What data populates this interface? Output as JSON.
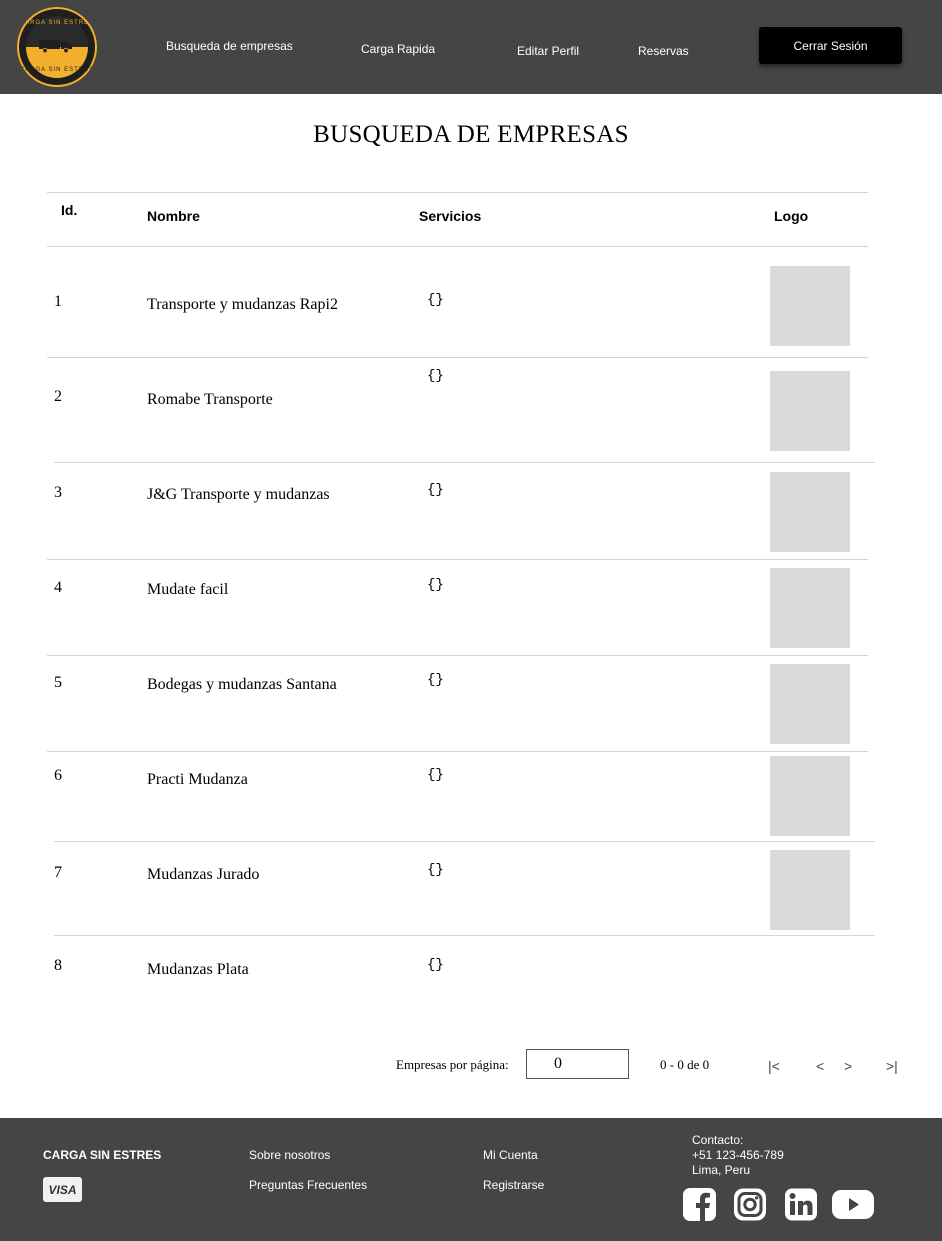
{
  "header": {
    "logo_text_top": "CARGA SIN ESTRES",
    "logo_text_bottom": "CARGA SIN ESTRES",
    "nav": [
      "Busqueda de empresas",
      "Carga Rapida",
      "Editar Perfil",
      "Reservas"
    ],
    "logout_label": "Cerrar Sesión"
  },
  "page_title": "BUSQUEDA DE EMPRESAS",
  "table": {
    "headers": {
      "id": "Id.",
      "name": "Nombre",
      "services": "Servicios",
      "logo": "Logo"
    },
    "rows": [
      {
        "id": "1",
        "name": "Transporte y mudanzas Rapi2",
        "services": "{}"
      },
      {
        "id": "2",
        "name": "Romabe Transporte",
        "services": "{}"
      },
      {
        "id": "3",
        "name": "J&G Transporte y mudanzas",
        "services": "{}"
      },
      {
        "id": "4",
        "name": "Mudate facil",
        "services": "{}"
      },
      {
        "id": "5",
        "name": "Bodegas y mudanzas Santana",
        "services": "{}"
      },
      {
        "id": "6",
        "name": "Practi Mudanza",
        "services": "{}"
      },
      {
        "id": "7",
        "name": "Mudanzas Jurado",
        "services": "{}"
      },
      {
        "id": "8",
        "name": "Mudanzas Plata",
        "services": "{}"
      }
    ]
  },
  "pagination": {
    "per_page_label": "Empresas por página:",
    "per_page_value": "0",
    "range_text": "0 - 0 de 0",
    "first": "|<",
    "prev": "<",
    "next": ">",
    "last": ">|"
  },
  "footer": {
    "brand": "CARGA SIN ESTRES",
    "payment": "VISA",
    "links_col1": [
      "Sobre nosotros",
      "Preguntas Frecuentes"
    ],
    "links_col2": [
      "Mi Cuenta",
      "Registrarse"
    ],
    "contact_label": "Contacto:",
    "contact_phone": "+51 123-456-789",
    "contact_city": "Lima, Peru",
    "social": [
      "facebook-icon",
      "instagram-icon",
      "linkedin-icon",
      "youtube-icon"
    ]
  },
  "colors": {
    "header_bg": "#454545",
    "accent": "#f3b02c",
    "logo_placeholder": "#d9d9d9"
  }
}
